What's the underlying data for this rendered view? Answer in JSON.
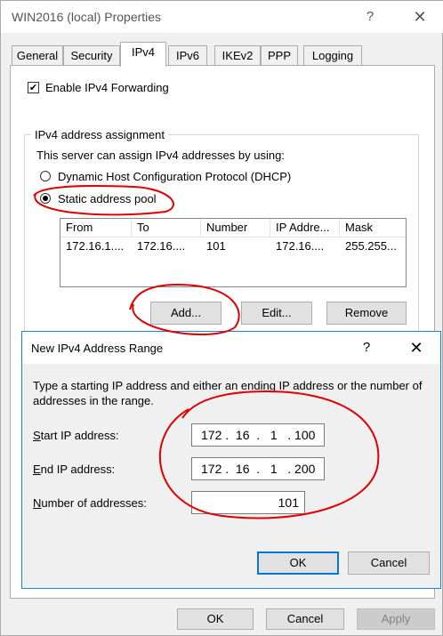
{
  "window": {
    "title": "WIN2016 (local) Properties",
    "help_icon": "?",
    "close_icon": "✕"
  },
  "tabs": [
    {
      "label": "General"
    },
    {
      "label": "Security"
    },
    {
      "label": "IPv4",
      "active": true
    },
    {
      "label": "IPv6"
    },
    {
      "label": "IKEv2"
    },
    {
      "label": "PPP"
    },
    {
      "label": "Logging"
    }
  ],
  "ipv4": {
    "forwarding_label": "Enable IPv4 Forwarding",
    "forwarding_checked": true,
    "group_title": "IPv4 address assignment",
    "assign_text": "This server can assign IPv4 addresses by using:",
    "dhcp_label": "Dynamic Host Configuration Protocol (DHCP)",
    "static_label": "Static address pool",
    "selected": "static",
    "pool_table": {
      "columns": [
        "From",
        "To",
        "Number",
        "IP Addre...",
        "Mask"
      ],
      "rows": [
        [
          "172.16.1....",
          "172.16....",
          "101",
          "172.16....",
          "255.255..."
        ]
      ]
    },
    "add_button": "Add...",
    "edit_button": "Edit...",
    "remove_button": "Remove"
  },
  "dialog": {
    "title": "New IPv4 Address Range",
    "help_icon": "?",
    "close_icon": "✕",
    "description": "Type a starting IP address and either an ending IP address or the number of addresses in the range.",
    "start_label": "Start IP address:",
    "start_value": "172 .  16  .   1   . 100",
    "end_label": "End IP address:",
    "end_value": "172 .  16  .   1   . 200",
    "count_label": "Number of addresses:",
    "count_value": "101",
    "ok_button": "OK",
    "cancel_button": "Cancel"
  },
  "footer": {
    "ok_button": "OK",
    "cancel_button": "Cancel",
    "apply_button": "Apply"
  },
  "annotation_color": "#e00000"
}
